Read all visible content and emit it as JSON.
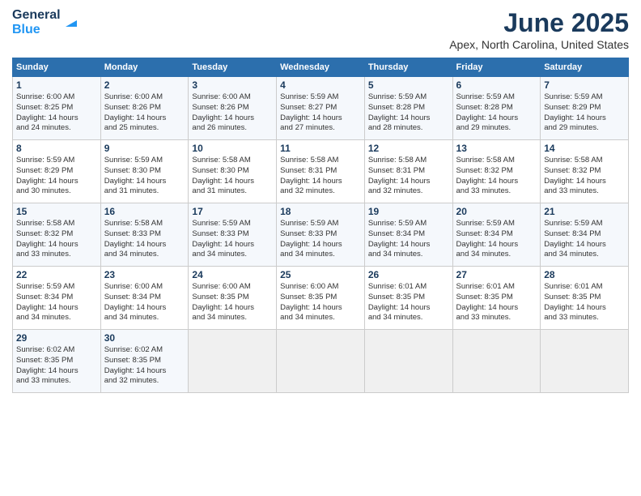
{
  "header": {
    "logo_line1": "General",
    "logo_line2": "Blue",
    "month": "June 2025",
    "location": "Apex, North Carolina, United States"
  },
  "days_of_week": [
    "Sunday",
    "Monday",
    "Tuesday",
    "Wednesday",
    "Thursday",
    "Friday",
    "Saturday"
  ],
  "weeks": [
    [
      {
        "day": "1",
        "rise": "6:00 AM",
        "set": "8:25 PM",
        "hours": "14 hours",
        "mins": "24 minutes."
      },
      {
        "day": "2",
        "rise": "6:00 AM",
        "set": "8:26 PM",
        "hours": "14 hours",
        "mins": "25 minutes."
      },
      {
        "day": "3",
        "rise": "6:00 AM",
        "set": "8:26 PM",
        "hours": "14 hours",
        "mins": "26 minutes."
      },
      {
        "day": "4",
        "rise": "5:59 AM",
        "set": "8:27 PM",
        "hours": "14 hours",
        "mins": "27 minutes."
      },
      {
        "day": "5",
        "rise": "5:59 AM",
        "set": "8:28 PM",
        "hours": "14 hours",
        "mins": "28 minutes."
      },
      {
        "day": "6",
        "rise": "5:59 AM",
        "set": "8:28 PM",
        "hours": "14 hours",
        "mins": "29 minutes."
      },
      {
        "day": "7",
        "rise": "5:59 AM",
        "set": "8:29 PM",
        "hours": "14 hours",
        "mins": "29 minutes."
      }
    ],
    [
      {
        "day": "8",
        "rise": "5:59 AM",
        "set": "8:29 PM",
        "hours": "14 hours",
        "mins": "30 minutes."
      },
      {
        "day": "9",
        "rise": "5:59 AM",
        "set": "8:30 PM",
        "hours": "14 hours",
        "mins": "31 minutes."
      },
      {
        "day": "10",
        "rise": "5:58 AM",
        "set": "8:30 PM",
        "hours": "14 hours",
        "mins": "31 minutes."
      },
      {
        "day": "11",
        "rise": "5:58 AM",
        "set": "8:31 PM",
        "hours": "14 hours",
        "mins": "32 minutes."
      },
      {
        "day": "12",
        "rise": "5:58 AM",
        "set": "8:31 PM",
        "hours": "14 hours",
        "mins": "32 minutes."
      },
      {
        "day": "13",
        "rise": "5:58 AM",
        "set": "8:32 PM",
        "hours": "14 hours",
        "mins": "33 minutes."
      },
      {
        "day": "14",
        "rise": "5:58 AM",
        "set": "8:32 PM",
        "hours": "14 hours",
        "mins": "33 minutes."
      }
    ],
    [
      {
        "day": "15",
        "rise": "5:58 AM",
        "set": "8:32 PM",
        "hours": "14 hours",
        "mins": "33 minutes."
      },
      {
        "day": "16",
        "rise": "5:58 AM",
        "set": "8:33 PM",
        "hours": "14 hours",
        "mins": "34 minutes."
      },
      {
        "day": "17",
        "rise": "5:59 AM",
        "set": "8:33 PM",
        "hours": "14 hours",
        "mins": "34 minutes."
      },
      {
        "day": "18",
        "rise": "5:59 AM",
        "set": "8:33 PM",
        "hours": "14 hours",
        "mins": "34 minutes."
      },
      {
        "day": "19",
        "rise": "5:59 AM",
        "set": "8:34 PM",
        "hours": "14 hours",
        "mins": "34 minutes."
      },
      {
        "day": "20",
        "rise": "5:59 AM",
        "set": "8:34 PM",
        "hours": "14 hours",
        "mins": "34 minutes."
      },
      {
        "day": "21",
        "rise": "5:59 AM",
        "set": "8:34 PM",
        "hours": "14 hours",
        "mins": "34 minutes."
      }
    ],
    [
      {
        "day": "22",
        "rise": "5:59 AM",
        "set": "8:34 PM",
        "hours": "14 hours",
        "mins": "34 minutes."
      },
      {
        "day": "23",
        "rise": "6:00 AM",
        "set": "8:34 PM",
        "hours": "14 hours",
        "mins": "34 minutes."
      },
      {
        "day": "24",
        "rise": "6:00 AM",
        "set": "8:35 PM",
        "hours": "14 hours",
        "mins": "34 minutes."
      },
      {
        "day": "25",
        "rise": "6:00 AM",
        "set": "8:35 PM",
        "hours": "14 hours",
        "mins": "34 minutes."
      },
      {
        "day": "26",
        "rise": "6:01 AM",
        "set": "8:35 PM",
        "hours": "14 hours",
        "mins": "34 minutes."
      },
      {
        "day": "27",
        "rise": "6:01 AM",
        "set": "8:35 PM",
        "hours": "14 hours",
        "mins": "33 minutes."
      },
      {
        "day": "28",
        "rise": "6:01 AM",
        "set": "8:35 PM",
        "hours": "14 hours",
        "mins": "33 minutes."
      }
    ],
    [
      {
        "day": "29",
        "rise": "6:02 AM",
        "set": "8:35 PM",
        "hours": "14 hours",
        "mins": "33 minutes."
      },
      {
        "day": "30",
        "rise": "6:02 AM",
        "set": "8:35 PM",
        "hours": "14 hours",
        "mins": "32 minutes."
      },
      null,
      null,
      null,
      null,
      null
    ]
  ]
}
